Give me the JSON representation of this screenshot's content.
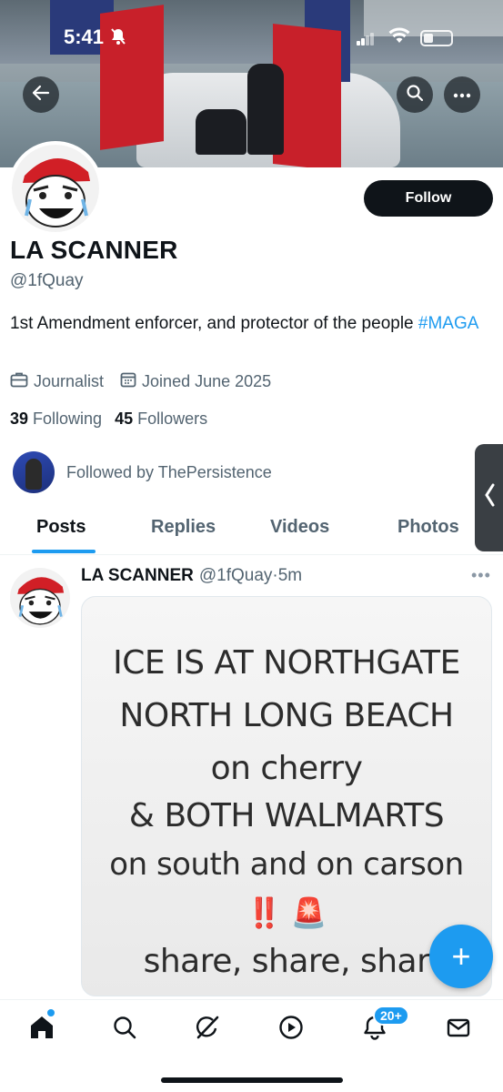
{
  "status_bar": {
    "time": "5:41",
    "icons": [
      "bell-slash-icon",
      "cellular-signal-icon",
      "wifi-icon",
      "battery-icon"
    ]
  },
  "header": {
    "back_icon": "arrow-left-icon",
    "search_icon": "search-icon",
    "more_icon": "more-horizontal-icon"
  },
  "profile": {
    "follow_label": "Follow",
    "display_name": "LA SCANNER",
    "handle": "@1fQuay",
    "bio_text": "1st Amendment enforcer, and protector of the people ",
    "bio_hashtag": "#MAGA",
    "category": "Journalist",
    "joined": "Joined June 2025",
    "following_count": "39",
    "following_label": "Following",
    "followers_count": "45",
    "followers_label": "Followers",
    "followed_by": "Followed by ThePersistence"
  },
  "tabs": [
    {
      "label": "Posts",
      "active": true
    },
    {
      "label": "Replies",
      "active": false
    },
    {
      "label": "Videos",
      "active": false
    },
    {
      "label": "Photos",
      "active": false
    }
  ],
  "post": {
    "author_name": "LA SCANNER",
    "author_handle": "@1fQuay",
    "separator": "·",
    "time_ago": "5m",
    "image_text": [
      "ICE IS AT NORTHGATE",
      "NORTH LONG BEACH",
      "on cherry",
      "& BOTH WALMARTS",
      "on south and on carson",
      "‼️ 🚨",
      "share, share, shar"
    ]
  },
  "fab_label": "+",
  "bottom_nav": {
    "items": [
      "home-icon",
      "search-icon",
      "grok-icon",
      "play-circle-icon",
      "notifications-bell-icon",
      "mail-icon"
    ],
    "notification_badge": "20+"
  },
  "colors": {
    "accent": "#1d9bf0",
    "text_primary": "#0f1419",
    "text_secondary": "#536471"
  }
}
